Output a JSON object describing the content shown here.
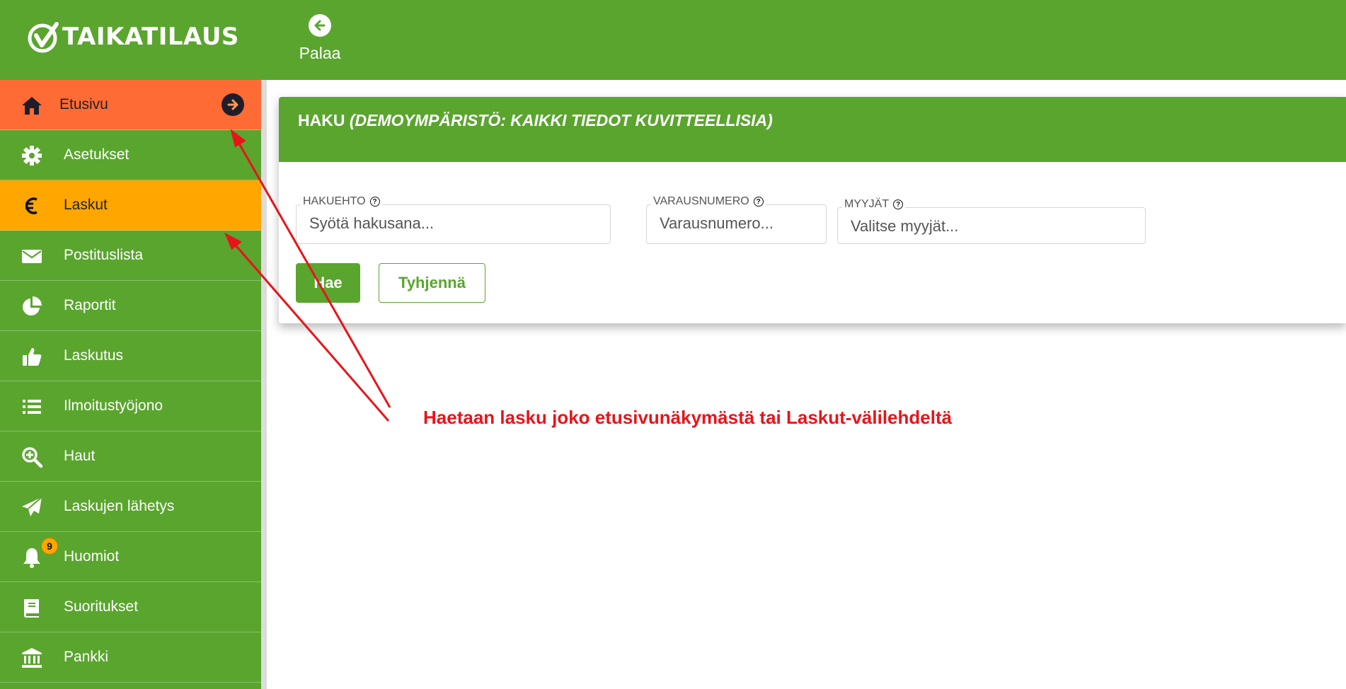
{
  "app": {
    "logo_text": "TAIKATILAUS"
  },
  "topbar": {
    "back_label": "Palaa"
  },
  "sidebar": {
    "items": [
      {
        "label": "Etusivu",
        "icon": "home-icon"
      },
      {
        "label": "Asetukset",
        "icon": "gear-icon"
      },
      {
        "label": "Laskut",
        "icon": "euro-icon"
      },
      {
        "label": "Postituslista",
        "icon": "envelope-icon"
      },
      {
        "label": "Raportit",
        "icon": "pie-chart-icon"
      },
      {
        "label": "Laskutus",
        "icon": "thumbs-up-icon"
      },
      {
        "label": "Ilmoitustyöjono",
        "icon": "list-icon"
      },
      {
        "label": "Haut",
        "icon": "search-plus-icon"
      },
      {
        "label": "Laskujen lähetys",
        "icon": "paper-plane-icon"
      },
      {
        "label": "Huomiot",
        "icon": "bell-icon",
        "badge": "9"
      },
      {
        "label": "Suoritukset",
        "icon": "book-icon"
      },
      {
        "label": "Pankki",
        "icon": "bank-icon"
      }
    ]
  },
  "search": {
    "title": "HAKU",
    "title_note": "(DEMOYMPÄRISTÖ: KAIKKI TIEDOT KUVITTEELLISIA)",
    "fields": {
      "query": {
        "label": "HAKUEHTO",
        "placeholder": "Syötä hakusana..."
      },
      "booking": {
        "label": "VARAUSNUMERO",
        "placeholder": "Varausnumero..."
      },
      "sellers": {
        "label": "MYYJÄT",
        "placeholder": "Valitse myyjät..."
      }
    },
    "search_button": "Hae",
    "clear_button": "Tyhjennä"
  },
  "annotation": {
    "text": "Haetaan lasku joko etusivunäkymästä tai Laskut-välilehdeltä",
    "color": "#e8141a"
  },
  "colors": {
    "brand_green": "#5aa52e",
    "home_orange": "#ff6b35",
    "active_amber": "#ffa600"
  }
}
